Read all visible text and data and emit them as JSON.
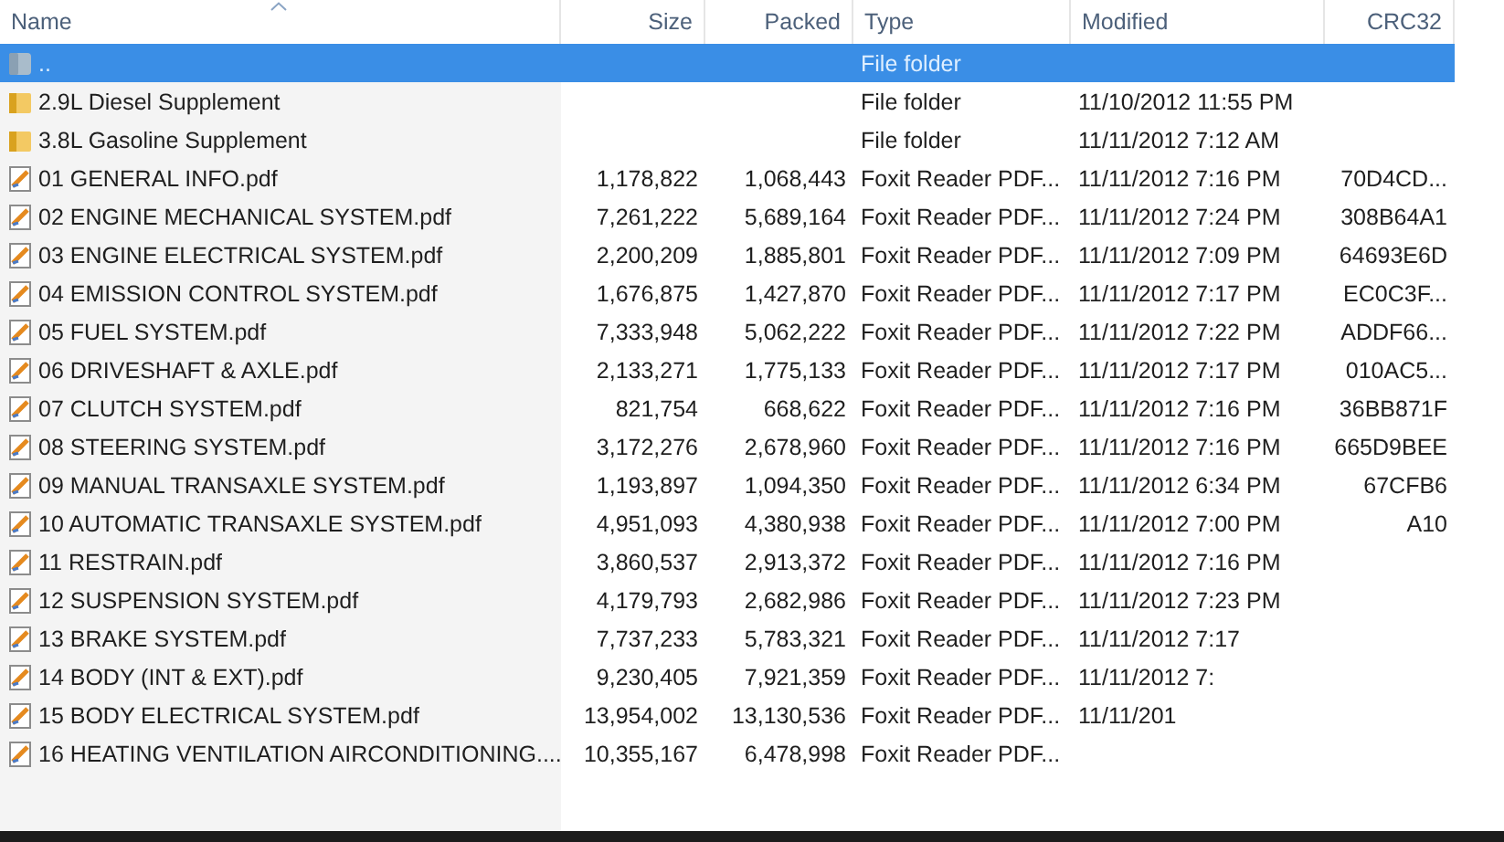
{
  "columns": [
    {
      "label": "Name",
      "sorted": true
    },
    {
      "label": "Size",
      "sorted": false
    },
    {
      "label": "Packed",
      "sorted": false
    },
    {
      "label": "Type",
      "sorted": false
    },
    {
      "label": "Modified",
      "sorted": false
    },
    {
      "label": "CRC32",
      "sorted": false
    }
  ],
  "rows": [
    {
      "kind": "up",
      "name": "..",
      "type": "File folder",
      "selected": true
    },
    {
      "kind": "folder",
      "name": "2.9L Diesel Supplement",
      "type": "File folder",
      "modified": "11/10/2012 11:55 PM",
      "selected": false
    },
    {
      "kind": "folder",
      "name": "3.8L Gasoline Supplement",
      "type": "File folder",
      "modified": "11/11/2012 7:12 AM",
      "selected": false
    },
    {
      "kind": "pdf",
      "name": "01 GENERAL INFO.pdf",
      "size": "1,178,822",
      "packed": "1,068,443",
      "type": "Foxit Reader PDF...",
      "modified": "11/11/2012 7:16 PM",
      "crc": "70D4CD...",
      "selected": false
    },
    {
      "kind": "pdf",
      "name": "02 ENGINE MECHANICAL SYSTEM.pdf",
      "size": "7,261,222",
      "packed": "5,689,164",
      "type": "Foxit Reader PDF...",
      "modified": "11/11/2012 7:24 PM",
      "crc": "308B64A1",
      "selected": false
    },
    {
      "kind": "pdf",
      "name": "03 ENGINE ELECTRICAL SYSTEM.pdf",
      "size": "2,200,209",
      "packed": "1,885,801",
      "type": "Foxit Reader PDF...",
      "modified": "11/11/2012 7:09 PM",
      "crc": "64693E6D",
      "selected": false
    },
    {
      "kind": "pdf",
      "name": "04 EMISSION CONTROL SYSTEM.pdf",
      "size": "1,676,875",
      "packed": "1,427,870",
      "type": "Foxit Reader PDF...",
      "modified": "11/11/2012 7:17 PM",
      "crc": "EC0C3F...",
      "selected": false
    },
    {
      "kind": "pdf",
      "name": "05 FUEL SYSTEM.pdf",
      "size": "7,333,948",
      "packed": "5,062,222",
      "type": "Foxit Reader PDF...",
      "modified": "11/11/2012 7:22 PM",
      "crc": "ADDF66...",
      "selected": false
    },
    {
      "kind": "pdf",
      "name": "06 DRIVESHAFT & AXLE.pdf",
      "size": "2,133,271",
      "packed": "1,775,133",
      "type": "Foxit Reader PDF...",
      "modified": "11/11/2012 7:17 PM",
      "crc": "010AC5...",
      "selected": false
    },
    {
      "kind": "pdf",
      "name": "07 CLUTCH SYSTEM.pdf",
      "size": "821,754",
      "packed": "668,622",
      "type": "Foxit Reader PDF...",
      "modified": "11/11/2012 7:16 PM",
      "crc": "36BB871F",
      "selected": false
    },
    {
      "kind": "pdf",
      "name": "08 STEERING SYSTEM.pdf",
      "size": "3,172,276",
      "packed": "2,678,960",
      "type": "Foxit Reader PDF...",
      "modified": "11/11/2012 7:16 PM",
      "crc": "665D9BEE",
      "selected": false
    },
    {
      "kind": "pdf",
      "name": "09 MANUAL TRANSAXLE SYSTEM.pdf",
      "size": "1,193,897",
      "packed": "1,094,350",
      "type": "Foxit Reader PDF...",
      "modified": "11/11/2012 6:34 PM",
      "crc": "67CFB6",
      "selected": false
    },
    {
      "kind": "pdf",
      "name": "10 AUTOMATIC TRANSAXLE SYSTEM.pdf",
      "size": "4,951,093",
      "packed": "4,380,938",
      "type": "Foxit Reader PDF...",
      "modified": "11/11/2012 7:00 PM",
      "crc": "A10",
      "selected": false
    },
    {
      "kind": "pdf",
      "name": "11 RESTRAIN.pdf",
      "size": "3,860,537",
      "packed": "2,913,372",
      "type": "Foxit Reader PDF...",
      "modified": "11/11/2012 7:16 PM",
      "selected": false
    },
    {
      "kind": "pdf",
      "name": "12 SUSPENSION SYSTEM.pdf",
      "size": "4,179,793",
      "packed": "2,682,986",
      "type": "Foxit Reader PDF...",
      "modified": "11/11/2012 7:23 PM",
      "selected": false
    },
    {
      "kind": "pdf",
      "name": "13 BRAKE SYSTEM.pdf",
      "size": "7,737,233",
      "packed": "5,783,321",
      "type": "Foxit Reader PDF...",
      "modified": "11/11/2012 7:17",
      "selected": false
    },
    {
      "kind": "pdf",
      "name": "14 BODY (INT & EXT).pdf",
      "size": "9,230,405",
      "packed": "7,921,359",
      "type": "Foxit Reader PDF...",
      "modified": "11/11/2012 7:",
      "selected": false
    },
    {
      "kind": "pdf",
      "name": "15 BODY ELECTRICAL SYSTEM.pdf",
      "size": "13,954,002",
      "packed": "13,130,536",
      "type": "Foxit Reader PDF...",
      "modified": "11/11/201",
      "selected": false
    },
    {
      "kind": "pdf",
      "name": "16 HEATING VENTILATION AIRCONDITIONING....",
      "size": "10,355,167",
      "packed": "6,478,998",
      "type": "Foxit Reader PDF...",
      "selected": false
    }
  ]
}
